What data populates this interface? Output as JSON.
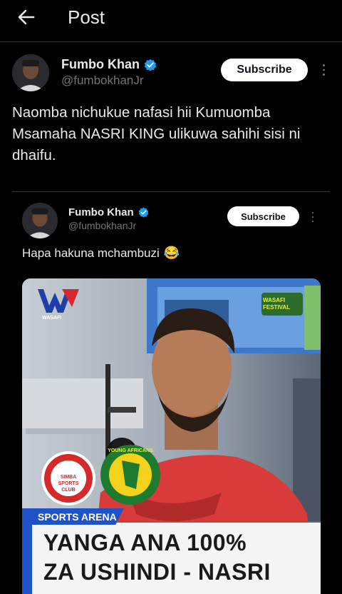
{
  "header": {
    "title": "Post"
  },
  "post": {
    "author_name": "Fumbo Khan",
    "author_handle": "@fumbokhanJr",
    "subscribe_label": "Subscribe",
    "text": "Naomba nichukue nafasi hii Kumuomba Msamaha NASRI KING ulikuwa sahihi sisi ni dhaifu."
  },
  "quote": {
    "author_name": "Fumbo Khan",
    "author_handle": "@fumbokhanJr",
    "subscribe_label": "Subscribe",
    "text": "Hapa hakuna mchambuzi",
    "emoji": "😂",
    "media": {
      "tag": "SPORTS ARENA",
      "headline_line1": "YANGA ANA 100%",
      "headline_line2": "ZA USHINDI - NASRI",
      "channel_logo": "WASAFI",
      "festival_badge": "WASAFI FESTIVAL",
      "club_logo_1": "SIMBA SPORTS CLUB",
      "club_logo_2": "YOUNG AFRICANS"
    }
  },
  "colors": {
    "background": "#000000",
    "text": "#e7e9ea",
    "secondary": "#71767b",
    "verified": "#1d9bf0",
    "banner_blue": "#1e54c8"
  },
  "icons": [
    "back-arrow-icon",
    "verified-badge-icon",
    "more-options-icon"
  ]
}
